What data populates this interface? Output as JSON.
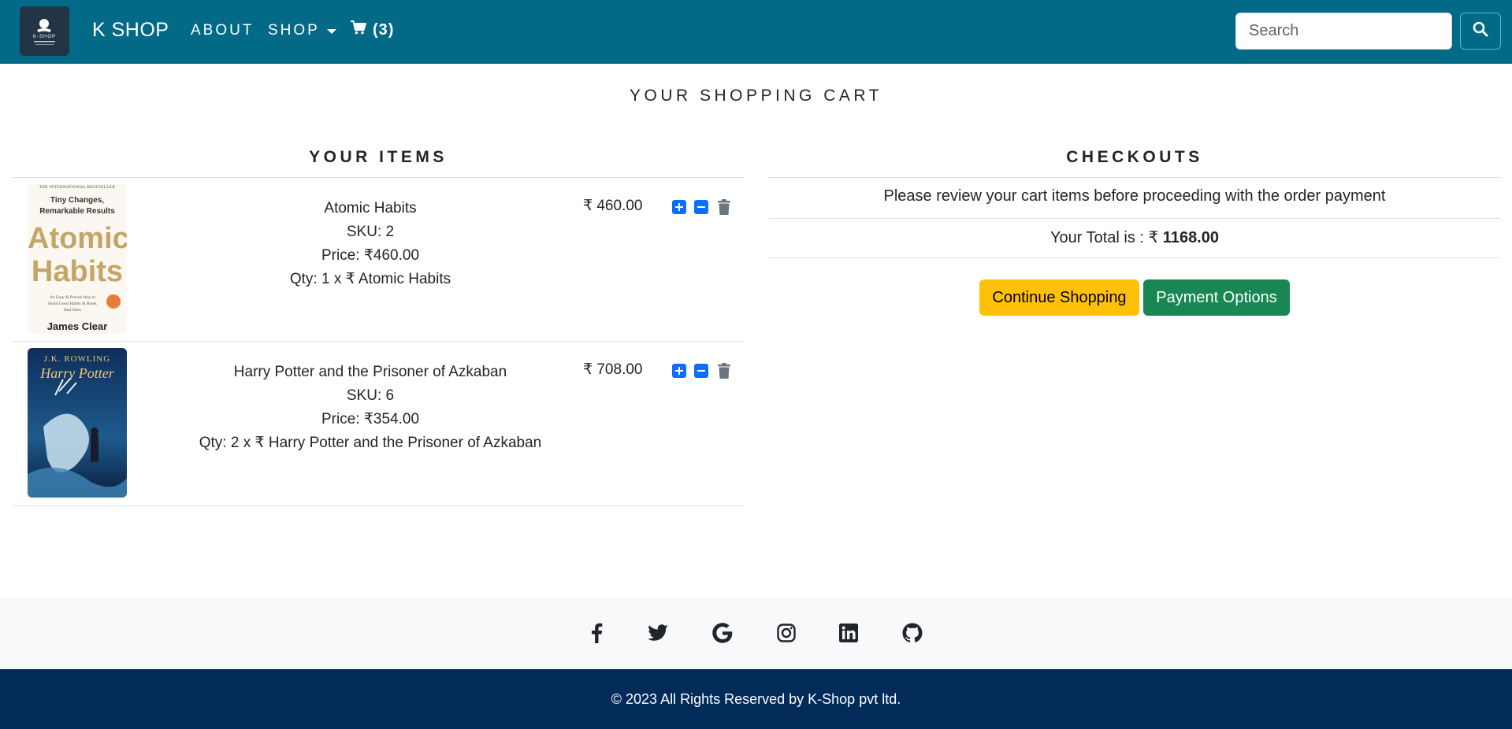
{
  "navbar": {
    "logo_text": "K-SHOP",
    "brand": "K SHOP",
    "about": "ABOUT",
    "shop": "SHOP",
    "cart_count": "(3)",
    "search_placeholder": "Search"
  },
  "page": {
    "title": "YOUR SHOPPING CART"
  },
  "items_section": {
    "heading": "YOUR ITEMS",
    "items": [
      {
        "name": "Atomic Habits",
        "sku": "SKU: 2",
        "price": "Price: ₹460.00",
        "qty": "Qty: 1 x ₹ Atomic Habits",
        "total": "₹ 460.00",
        "cover": {
          "top_text": "THE INTERNATIONAL BESTSELLER",
          "tagline_1": "Tiny Changes,",
          "tagline_2": "Remarkable Results",
          "title_1": "Atomic",
          "title_2": "Habits",
          "subtitle": "An Easy & Proven Way to Build Good Habits & Break Bad Ones",
          "author": "James Clear"
        }
      },
      {
        "name": "Harry Potter and the Prisoner of Azkaban",
        "sku": "SKU: 6",
        "price": "Price: ₹354.00",
        "qty": "Qty: 2 x ₹ Harry Potter and the Prisoner of Azkaban",
        "total": "₹ 708.00",
        "cover": {
          "author": "J.K. ROWLING",
          "title": "Harry Potter"
        }
      }
    ]
  },
  "checkout": {
    "heading": "CHECKOUTS",
    "message": "Please review your cart items before proceeding with the order payment",
    "total_label": "Your Total is : ₹ ",
    "total_value": "1168.00",
    "continue_label": "Continue Shopping",
    "payment_label": "Payment Options"
  },
  "footer": {
    "social_icons": [
      "facebook-icon",
      "twitter-icon",
      "google-icon",
      "instagram-icon",
      "linkedin-icon",
      "github-icon"
    ],
    "copyright": "© 2023 All Rights Reserved by K-Shop pvt ltd."
  },
  "colors": {
    "navbar": "#026987",
    "primary": "#0d6efd",
    "warning": "#ffc107",
    "success": "#198754",
    "footer_dark": "#032b5a",
    "footer_light": "#f8f9fa"
  }
}
